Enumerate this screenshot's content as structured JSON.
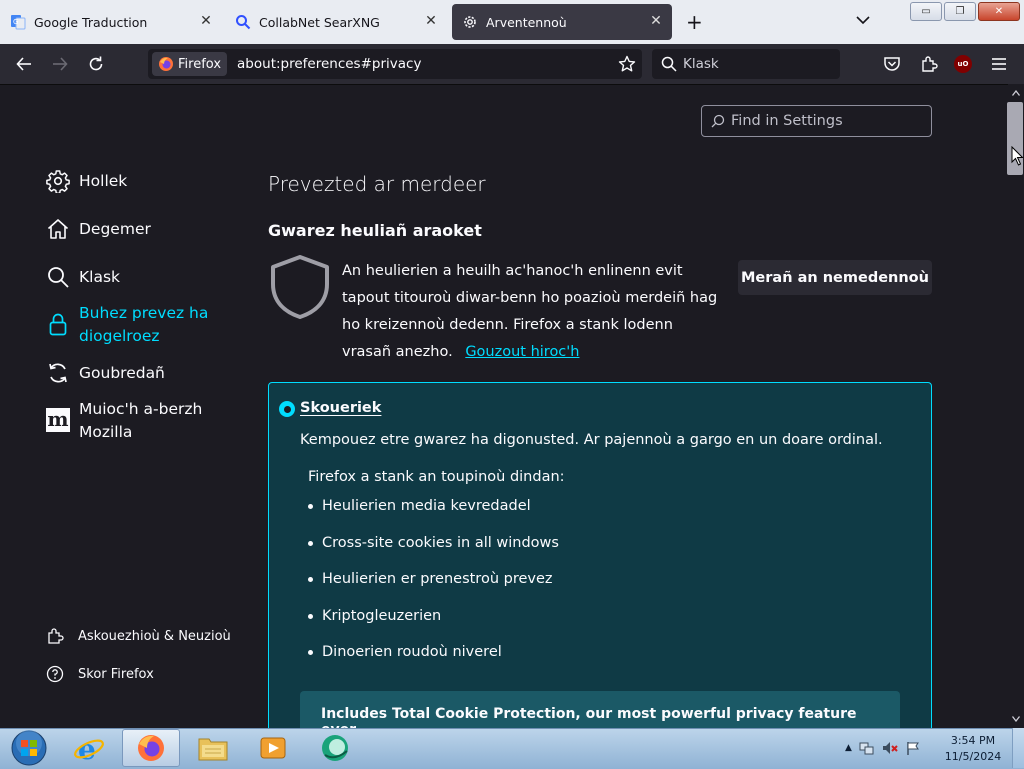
{
  "tabs": [
    {
      "title": "Google Traduction",
      "icon": "google-translate-icon",
      "active": false
    },
    {
      "title": "CollabNet SearXNG",
      "icon": "search-icon",
      "active": false
    },
    {
      "title": "Arventennoù",
      "icon": "gear-icon",
      "active": true
    }
  ],
  "toolbar": {
    "identity_label": "Firefox",
    "url": "about:preferences#privacy",
    "search_placeholder": "Klask"
  },
  "find_in_settings": {
    "placeholder": "Find in Settings"
  },
  "sidebar": {
    "items": [
      {
        "label": "Hollek",
        "icon": "gear-icon"
      },
      {
        "label": "Degemer",
        "icon": "home-icon"
      },
      {
        "label": "Klask",
        "icon": "search-icon"
      },
      {
        "label": "Buhez prevez ha diogelroez",
        "icon": "lock-icon",
        "active": true
      },
      {
        "label": "Goubredañ",
        "icon": "sync-icon"
      },
      {
        "label": "Muioc'h a-berzh Mozilla",
        "icon": "mozilla-icon"
      }
    ],
    "footer": [
      {
        "label": "Askouezhioù & Neuzioù",
        "icon": "puzzle-icon"
      },
      {
        "label": "Skor Firefox",
        "icon": "help-icon"
      }
    ]
  },
  "content": {
    "page_title": "Prevezted ar merdeer",
    "section_title": "Gwarez heuliañ araoket",
    "description": "An heulierien a heuilh ac'hanoc'h enlinenn evit tapout titouroù diwar-benn ho poazioù merdeiñ hag ho kreizennoù dedenn. Firefox a stank lodenn vrasañ anezho.",
    "learn_more": "Gouzout hiroc'h",
    "manage_button": "Merañ an nemedennoù",
    "standard": {
      "title": "Skoueriek",
      "description": "Kempouez etre gwarez ha digonusted. Ar pajennoù a gargo en un doare ordinal.",
      "blocks_heading": "Firefox a stank an toupinoù dindan:",
      "blocks": [
        "Heulierien media kevredadel",
        "Cross-site cookies in all windows",
        "Heulierien er prenestroù prevez",
        "Kriptogleuzerien",
        "Dinoerien roudoù niverel"
      ],
      "tcp_banner": "Includes Total Cookie Protection, our most powerful privacy feature ever"
    }
  },
  "taskbar": {
    "apps": [
      "start-orb",
      "internet-explorer",
      "firefox",
      "file-explorer",
      "media-player",
      "app"
    ],
    "time": "3:54 PM",
    "date": "11/5/2024"
  },
  "colors": {
    "accent": "#00ddff",
    "page_bg": "#1c1b22",
    "toolbar_bg": "#2b2a33",
    "selected_box_bg": "#0f3a45"
  }
}
